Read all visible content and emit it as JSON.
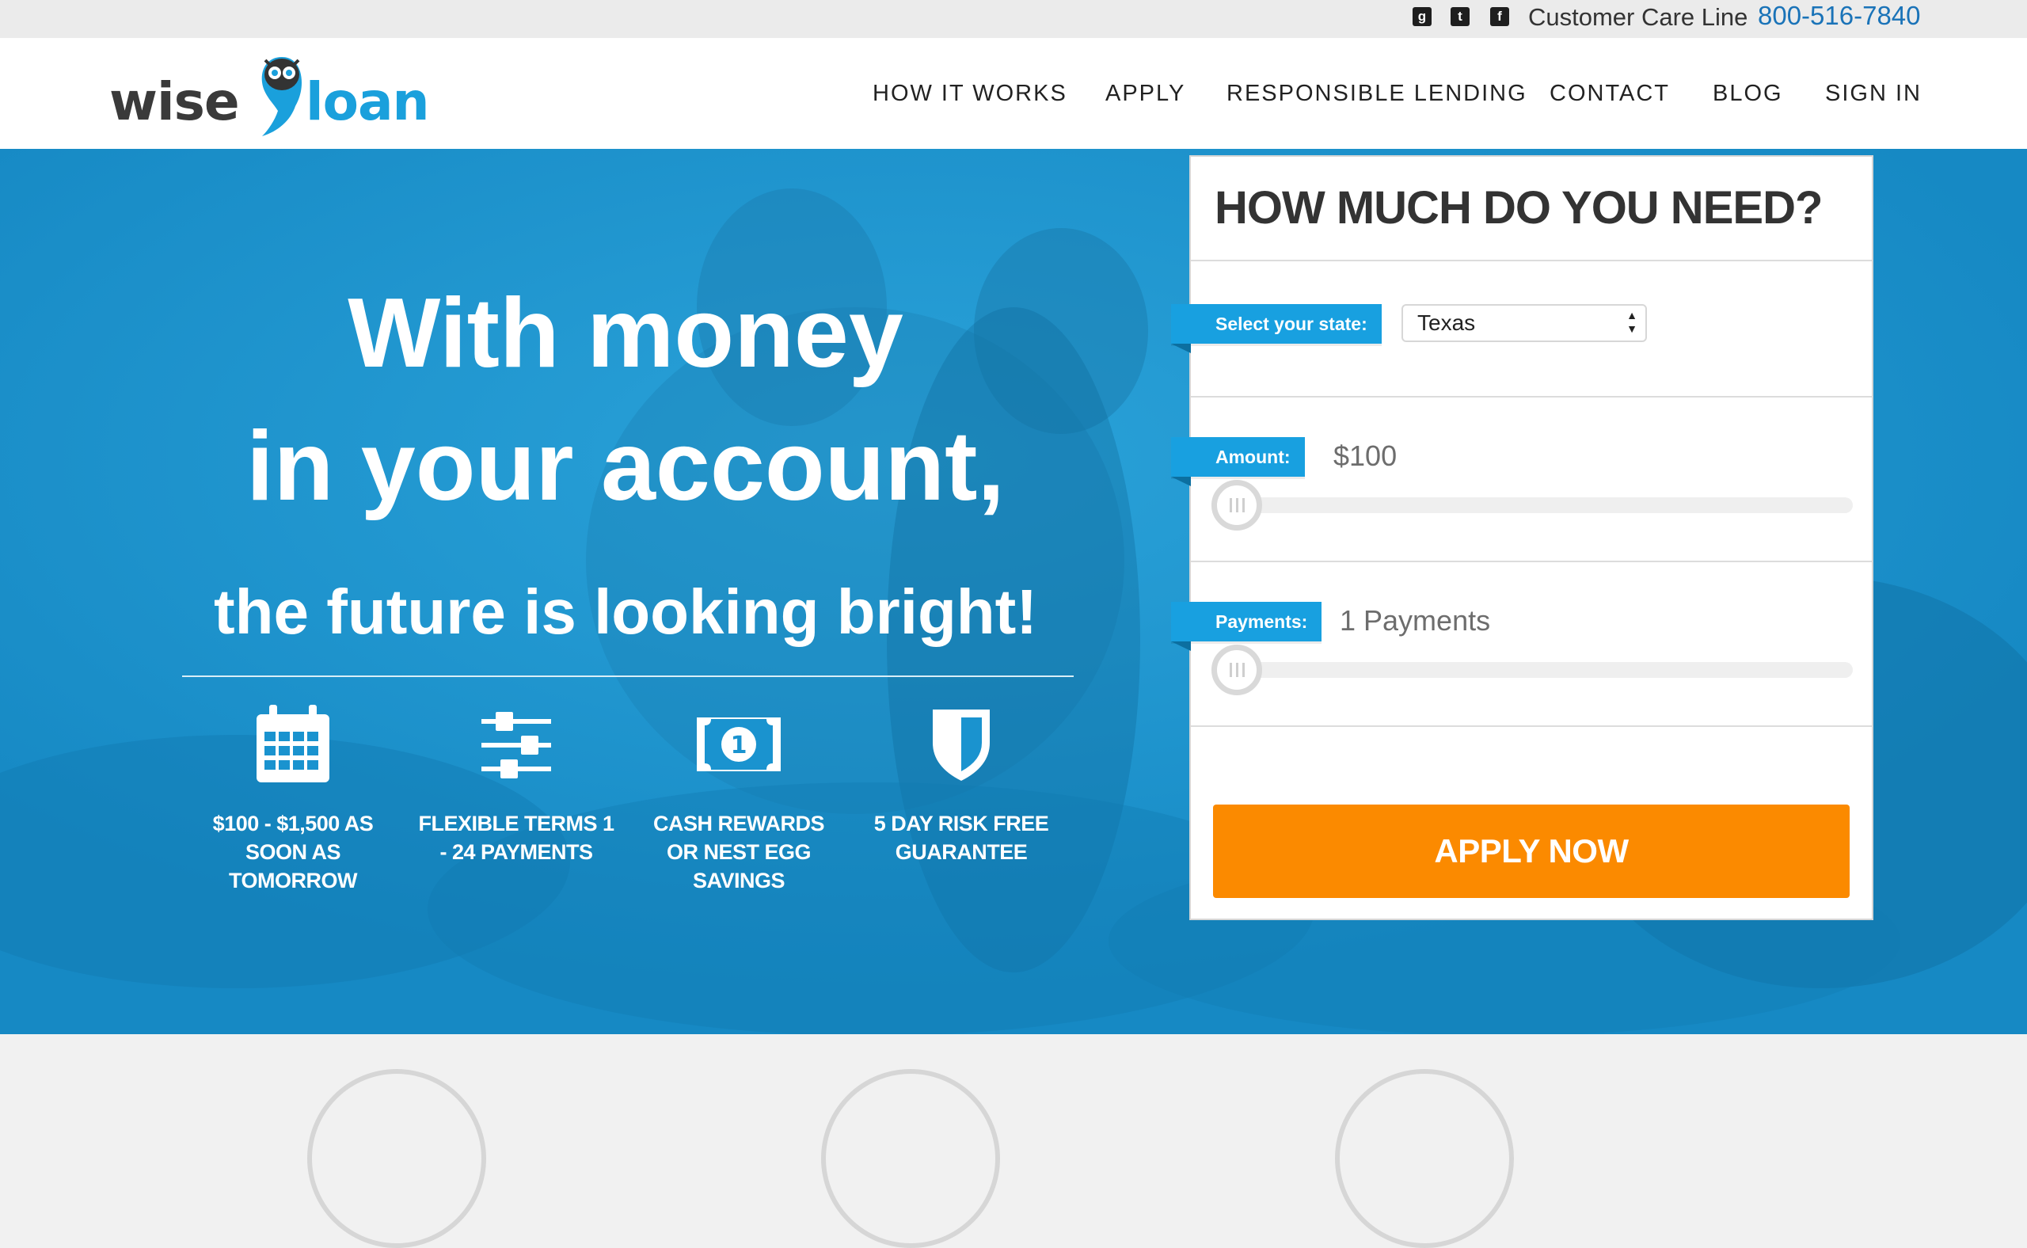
{
  "topbar": {
    "social_icons": [
      "google-plus-icon",
      "twitter-icon",
      "facebook-icon"
    ],
    "care_label": "Customer Care Line",
    "phone": "800-516-7840"
  },
  "logo": {
    "part1": "wise",
    "part2": "loan"
  },
  "nav": {
    "items": [
      {
        "label": "HOW IT WORKS"
      },
      {
        "label": "APPLY"
      },
      {
        "label": "RESPONSIBLE LENDING"
      },
      {
        "label": "CONTACT"
      },
      {
        "label": "BLOG"
      },
      {
        "label": "SIGN IN"
      }
    ]
  },
  "hero": {
    "line1": "With money",
    "line2": "in your account,",
    "line3": "the future is looking bright!",
    "features": [
      {
        "icon": "calendar-icon",
        "text": "$100 - $1,500 AS SOON AS TOMORROW"
      },
      {
        "icon": "sliders-icon",
        "text": "FLEXIBLE TERMS 1 - 24 PAYMENTS"
      },
      {
        "icon": "banknote-icon",
        "text": "CASH REWARDS OR NEST EGG SAVINGS"
      },
      {
        "icon": "shield-icon",
        "text": "5 DAY RISK FREE GUARANTEE"
      }
    ]
  },
  "form": {
    "title": "HOW MUCH DO YOU NEED?",
    "state_label": "Select your state:",
    "state_value": "Texas",
    "amount_label": "Amount:",
    "amount_value": "$100",
    "amount_slider_level": 0,
    "payments_label": "Payments:",
    "payments_value": "1 Payments",
    "payments_slider_level": 0,
    "apply_label": "APPLY NOW"
  },
  "colors": {
    "brand_blue": "#1aa0dc",
    "hero_blue": "#1a93cf",
    "apply_orange": "#fb8a00",
    "phone_blue": "#1a73b8"
  }
}
